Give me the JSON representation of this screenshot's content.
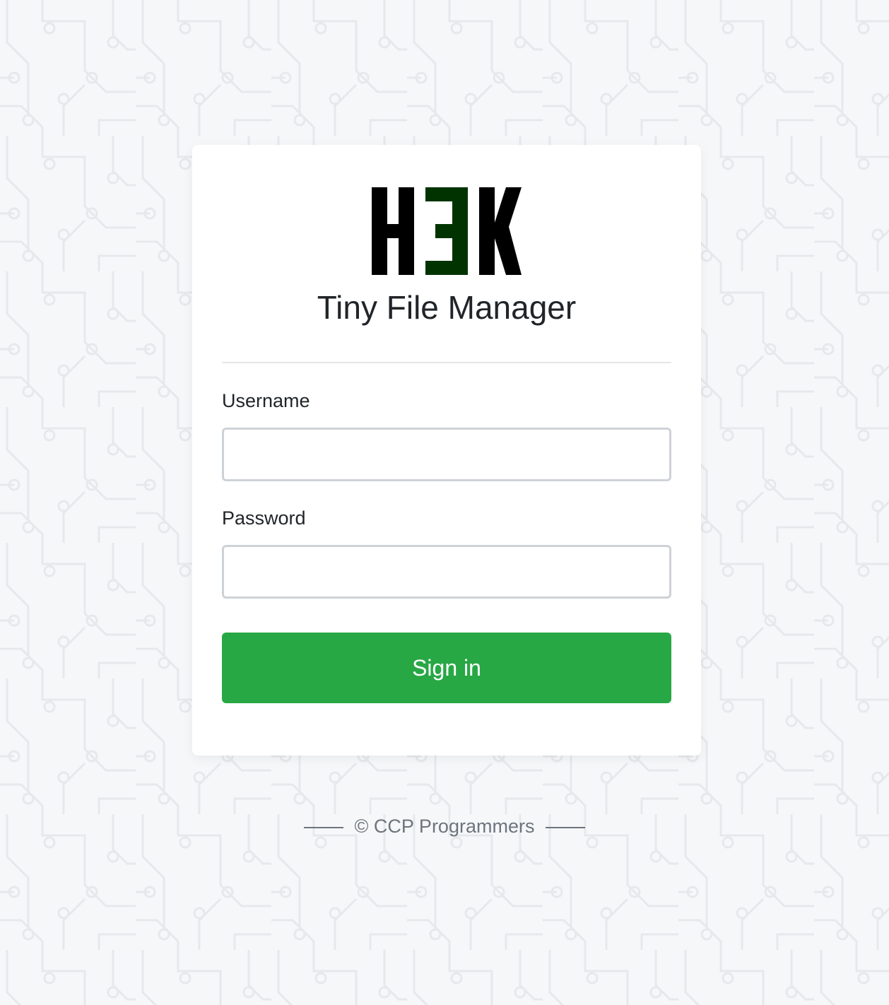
{
  "logo": {
    "alt": "H3K",
    "letters": [
      "H",
      "3",
      "K"
    ],
    "colors": {
      "dark": "#000000",
      "accent": "#003300"
    }
  },
  "app": {
    "title": "Tiny File Manager"
  },
  "form": {
    "username_label": "Username",
    "username_value": "",
    "password_label": "Password",
    "password_value": "",
    "submit_label": "Sign in"
  },
  "footer": {
    "text": "© CCP Programmers"
  },
  "theme": {
    "primary": "#28a745",
    "background": "#f6f7f9",
    "text": "#212529",
    "muted": "#6c757d"
  }
}
